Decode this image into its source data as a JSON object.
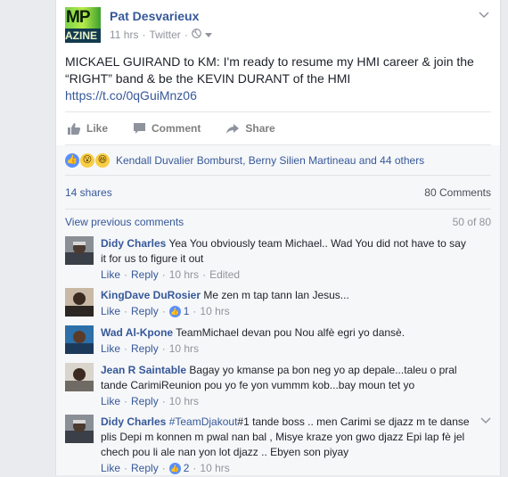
{
  "post": {
    "author": "Pat Desvarieux",
    "avatar_text_top": "MP",
    "avatar_text_bottom": "AZINE",
    "time": "11 hrs",
    "source": "Twitter",
    "text": "MICKAEL GUIRAND to KM: I'm ready to resume my HMI career & join the “RIGHT” band & be the KEVIN DURANT of the HMI",
    "link": "https://t.co/0qGuiMnz06"
  },
  "actions": {
    "like": "Like",
    "comment": "Comment",
    "share": "Share"
  },
  "reactions": {
    "icons": [
      "like-icon",
      "wow-icon",
      "haha-icon"
    ],
    "text": "Kendall Duvalier Bomburst, Berny Silien Martineau and 44 others"
  },
  "stats": {
    "shares": "14 shares",
    "comments": "80 Comments"
  },
  "previous": {
    "label": "View previous comments",
    "count": "50 of 80"
  },
  "comments": [
    {
      "name": "Didy Charles",
      "text": "Yea You obviously team Michael.. Wad You did not have to say it for us to figure it out",
      "like": "Like",
      "reply": "Reply",
      "time": "10 hrs",
      "edited": "Edited"
    },
    {
      "name": "KingDave DuRosier",
      "text": "Me zen m tap tann lan Jesus...",
      "like": "Like",
      "reply": "Reply",
      "likes": "1",
      "time": "10 hrs"
    },
    {
      "name": "Wad Al-Kpone",
      "text": "TeamMichael devan pou Nou alfè egri yo dansè.",
      "like": "Like",
      "reply": "Reply",
      "time": "10 hrs"
    },
    {
      "name": "Jean R Saintable",
      "text": "Bagay yo kmanse pa bon neg yo ap depale...taleu o pral tande CarimiReunion pou yo fe yon vummm kob...bay moun tet yo",
      "like": "Like",
      "reply": "Reply",
      "time": "10 hrs"
    },
    {
      "name": "Didy Charles",
      "hashtag": "#TeamDjakout",
      "text": "#1 tande boss .. men Carimi se djazz m te danse plis Depi m konnen m pwal nan bal , Misye kraze yon gwo djazz Epi lap fè jel chech pou li ale nan yon lot djazz .. Ebyen son piyay",
      "like": "Like",
      "reply": "Reply",
      "likes": "2",
      "time": "10 hrs"
    }
  ],
  "colors": {
    "link": "#365899",
    "meta": "#90949c",
    "like_blue": "#5890ff"
  }
}
